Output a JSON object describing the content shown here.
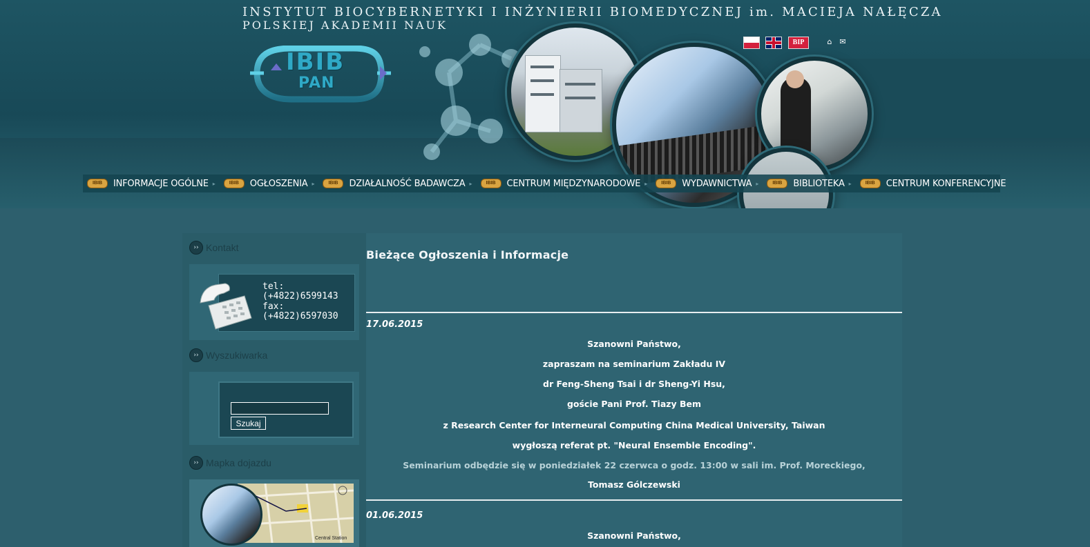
{
  "header": {
    "title_line1": "INSTYTUT BIOCYBERNETYKI I INŻYNIERII BIOMEDYCZNEJ im. MACIEJA NAŁĘCZA",
    "title_line2": "POLSKIEJ AKADEMII NAUK",
    "logo": {
      "text_top": "IBIB",
      "text_bottom": "PAN"
    },
    "bip_label": "BIP"
  },
  "nav": {
    "badge": "IBIB",
    "items": [
      {
        "label": "INFORMACJE OGÓLNE"
      },
      {
        "label": "OGŁOSZENIA"
      },
      {
        "label": "DZIAŁALNOŚĆ BADAWCZA"
      },
      {
        "label": "CENTRUM MIĘDZYNARODOWE"
      },
      {
        "label": "WYDAWNICTWA"
      },
      {
        "label": "BIBLIOTEKA"
      },
      {
        "label": "CENTRUM KONFERENCYJNE"
      }
    ]
  },
  "sidebar": {
    "contact": {
      "title": "Kontakt",
      "tel_label": "tel:",
      "tel_value": "(+4822)6599143",
      "fax_label": "fax:",
      "fax_value": "(+4822)6597030"
    },
    "search": {
      "title": "Wyszukiwarka",
      "input_value": "",
      "button_label": "Szukaj"
    },
    "map": {
      "title": "Mapka dojazdu",
      "station_label": "Central Station"
    }
  },
  "content": {
    "title": "Bieżące Ogłoszenia i Informacje",
    "announcements": [
      {
        "date": "17.06.2015",
        "lines": [
          "Szanowni Państwo,",
          "zapraszam na seminarium Zakładu IV",
          "dr Feng-Sheng Tsai i dr Sheng-Yi Hsu,",
          "goście Pani Prof. Tiazy Bem",
          "z Research Center for Interneural Computing  China Medical University, Taiwan",
          "wygłoszą referat pt. \"Neural Ensemble Encoding\".",
          "Seminarium odbędzie się w poniedziałek 22 czerwca o godz. 13:00 w sali im. Prof. Moreckiego,",
          "Tomasz Gólczewski"
        ]
      },
      {
        "date": "01.06.2015",
        "lines": [
          "Szanowni Państwo,"
        ]
      }
    ]
  },
  "colors": {
    "page_bg": "#2d5f6d",
    "header_bg": "#184957",
    "nav_badge": "#d9a441",
    "content_bg": "#2f6472"
  }
}
